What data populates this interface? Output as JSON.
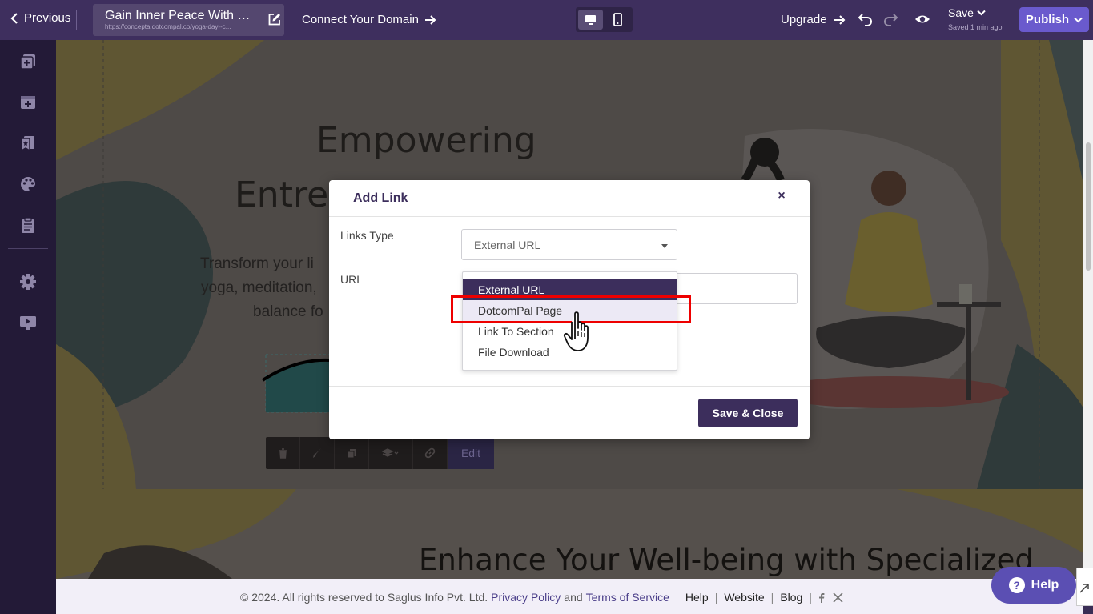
{
  "topbar": {
    "previous_label": "Previous",
    "page_title": "Gain Inner Peace With Co...",
    "page_url": "https://concepta.dotcompal.co/yoga-day--c...",
    "connect_domain_label": "Connect Your Domain",
    "upgrade_label": "Upgrade",
    "save_label": "Save",
    "saved_time": "Saved 1 min ago",
    "publish_label": "Publish"
  },
  "canvas": {
    "hero_title_line1": "Empowering",
    "hero_title_line2": "Entrep",
    "hero_text_line1": "Transform your li",
    "hero_text_line2": "yoga, meditation,",
    "hero_text_line3": "balance fo",
    "section_title": "Enhance Your Well-being with Specialized",
    "edit_toolbar_label": "Edit"
  },
  "modal": {
    "title": "Add Link",
    "close_symbol": "×",
    "links_type_label": "Links Type",
    "links_type_value": "External URL",
    "url_label": "URL",
    "save_close_label": "Save & Close",
    "dropdown_options": [
      "External URL",
      "DotcomPal Page",
      "Link To Section",
      "File Download"
    ]
  },
  "footer": {
    "copyright": "©  2024. All rights reserved to Saglus Info Pvt. Ltd.",
    "privacy_label": "Privacy Policy",
    "and_text": "and",
    "terms_label": "Terms of Service",
    "help_label": "Help",
    "website_label": "Website",
    "blog_label": "Blog",
    "separator": "|"
  },
  "help_widget": {
    "label": "Help",
    "icon_text": "?"
  },
  "colors": {
    "topbar": "#3e2f5e",
    "sidebar": "#231a37",
    "publish": "#6a5acd",
    "modal_accent": "#3c2e5c",
    "highlight": "#e00000"
  }
}
